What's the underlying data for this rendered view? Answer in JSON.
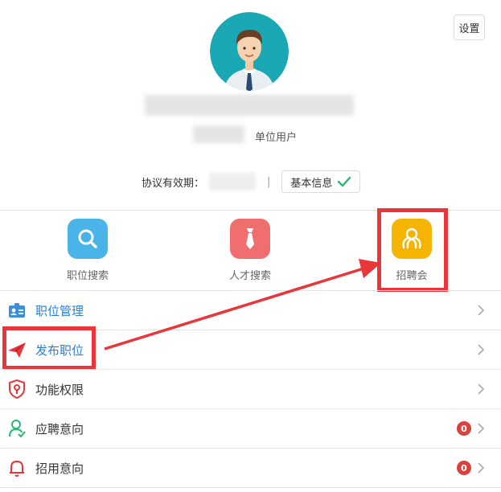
{
  "header": {
    "settings_label": "设置",
    "user_type": "单位用户",
    "agreement_label": "协议有效期：",
    "basic_info_label": "基本信息"
  },
  "quick_actions": [
    {
      "label": "职位搜索",
      "icon": "search-icon",
      "color": "#4ab3e8"
    },
    {
      "label": "人才搜索",
      "icon": "tie-icon",
      "color": "#f06e6e"
    },
    {
      "label": "招聘会",
      "icon": "handshake-icon",
      "color": "#f5b400"
    }
  ],
  "menu": [
    {
      "label": "职位管理",
      "icon": "id-card-icon",
      "badge": null
    },
    {
      "label": "发布职位",
      "icon": "paper-plane-icon",
      "badge": null
    },
    {
      "label": "功能权限",
      "icon": "key-icon",
      "badge": null
    },
    {
      "label": "应聘意向",
      "icon": "user-icon",
      "badge": "0"
    },
    {
      "label": "招用意向",
      "icon": "bell-icon",
      "badge": "0"
    }
  ],
  "colors": {
    "annotation_red": "#e8363b",
    "link_blue": "#2a7fd4",
    "check_green": "#2bb673",
    "badge_red": "#d9423c"
  }
}
